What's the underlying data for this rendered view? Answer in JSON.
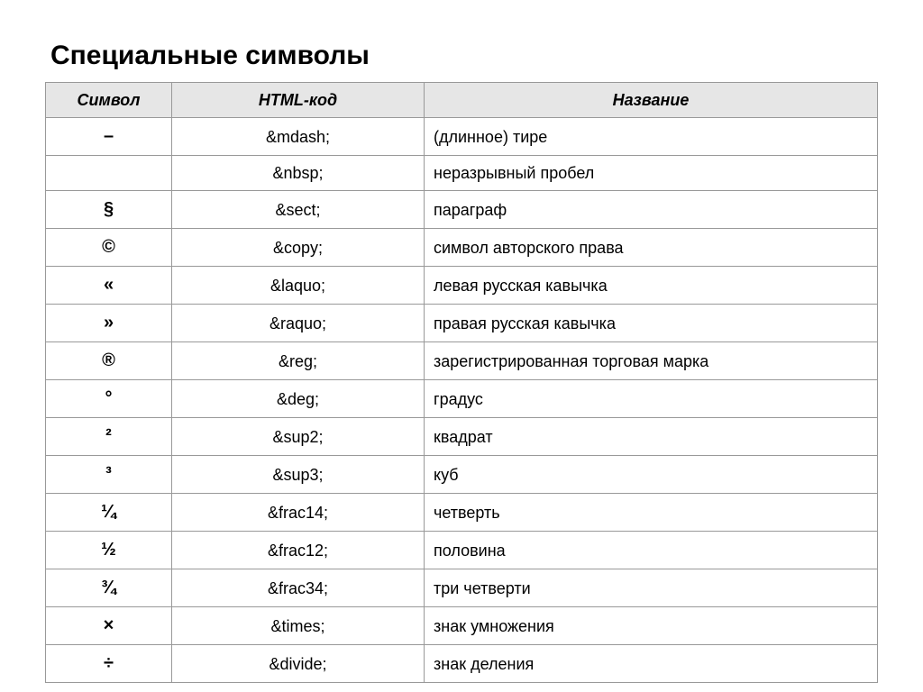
{
  "heading": "Специальные символы",
  "columns": {
    "symbol": "Символ",
    "code": "HTML-код",
    "name": "Название"
  },
  "rows": [
    {
      "symbol": "–",
      "code": "&mdash;",
      "name": "(длинное) тире"
    },
    {
      "symbol": " ",
      "code": "&nbsp;",
      "name": "неразрывный пробел"
    },
    {
      "symbol": "§",
      "code": "&sect;",
      "name": "параграф"
    },
    {
      "symbol": "©",
      "code": "&copy;",
      "name": "символ авторского права"
    },
    {
      "symbol": "«",
      "code": "&laquo;",
      "name": "левая русская кавычка"
    },
    {
      "symbol": "»",
      "code": "&raquo;",
      "name": "правая русская кавычка"
    },
    {
      "symbol": "®",
      "code": "&reg;",
      "name": "зарегистрированная торговая марка"
    },
    {
      "symbol": "°",
      "code": "&deg;",
      "name": "градус"
    },
    {
      "symbol": "²",
      "code": "&sup2;",
      "name": "квадрат"
    },
    {
      "symbol": "³",
      "code": "&sup3;",
      "name": "куб"
    },
    {
      "symbol": "¼",
      "code": "&frac14;",
      "name": "четверть"
    },
    {
      "symbol": "½",
      "code": "&frac12;",
      "name": "половина"
    },
    {
      "symbol": "¾",
      "code": "&frac34;",
      "name": "три четверти"
    },
    {
      "symbol": "×",
      "code": "&times;",
      "name": "знак умножения"
    },
    {
      "symbol": "÷",
      "code": "&divide;",
      "name": "знак деления"
    }
  ]
}
